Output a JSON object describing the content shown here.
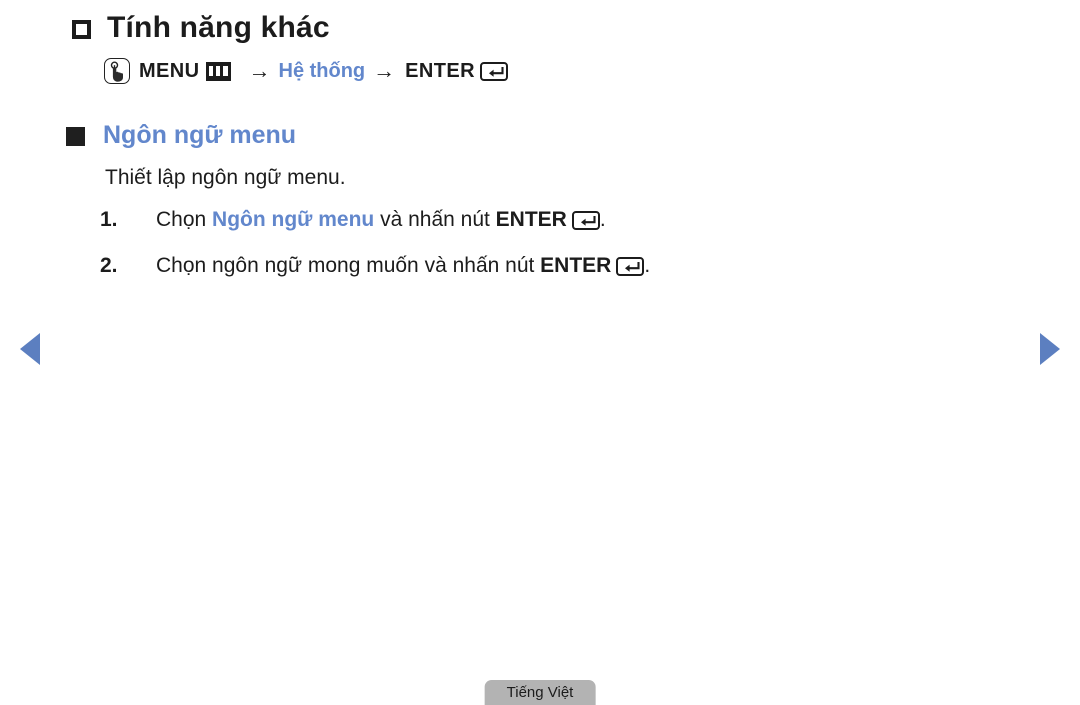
{
  "page": {
    "background_color": "#ffffff",
    "accent_color": "#6287cc",
    "text_color": "#1c1c1c",
    "nav_arrow_color": "#5c7fc0"
  },
  "section": {
    "bullet_icon": "hollow-square-bullet-icon",
    "title": "Tính năng khác"
  },
  "menu_path": {
    "hand_icon": "hand-press-icon",
    "menu_label": "MENU",
    "menu_bars_icon": "menu-bars-icon",
    "arrow_1": "→",
    "destination": "Hệ thống",
    "arrow_2": "→",
    "enter_label": "ENTER",
    "enter_icon": "enter-key-icon"
  },
  "subsection": {
    "bullet_icon": "solid-square-bullet-icon",
    "title": "Ngôn ngữ menu",
    "description": "Thiết lập ngôn ngữ menu."
  },
  "steps": [
    {
      "number": "1.",
      "text_before": "Chọn ",
      "highlight": "Ngôn ngữ menu",
      "text_middle": " và nhấn nút ",
      "bold_label": "ENTER",
      "enter_icon": "enter-key-icon",
      "text_after": "."
    },
    {
      "number": "2.",
      "text_before": "Chọn ngôn ngữ mong muốn và nhấn nút ",
      "highlight": "",
      "text_middle": "",
      "bold_label": "ENTER",
      "enter_icon": "enter-key-icon",
      "text_after": "."
    }
  ],
  "navigation": {
    "prev_icon": "triangle-left-icon",
    "next_icon": "triangle-right-icon"
  },
  "footer": {
    "language_badge": "Tiếng Việt"
  }
}
